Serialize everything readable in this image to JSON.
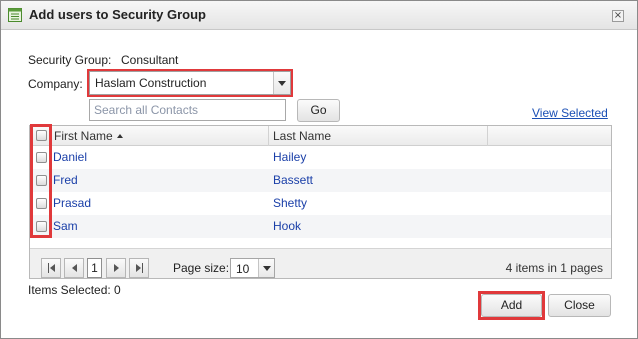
{
  "dialog": {
    "title": "Add users to Security Group",
    "close_glyph": "×"
  },
  "security_group": {
    "label": "Security Group:",
    "value": "Consultant"
  },
  "company": {
    "label": "Company:",
    "selected": "Haslam Construction"
  },
  "search": {
    "value": "",
    "placeholder": "Search all Contacts",
    "go_label": "Go"
  },
  "view_selected_label": "View Selected",
  "table": {
    "columns": [
      "First Name",
      "Last Name",
      ""
    ],
    "sort": {
      "column": "First Name",
      "direction": "ascending"
    },
    "rows": [
      {
        "first": "Daniel",
        "last": "Hailey",
        "checked": false
      },
      {
        "first": "Fred",
        "last": "Bassett",
        "checked": false
      },
      {
        "first": "Prasad",
        "last": "Shetty",
        "checked": false
      },
      {
        "first": "Sam",
        "last": "Hook",
        "checked": false
      }
    ]
  },
  "pager": {
    "current_page": "1",
    "page_size_label": "Page size:",
    "page_size": "10",
    "info": "4 items in 1 pages"
  },
  "footer": {
    "items_selected": "Items Selected: 0",
    "add_label": "Add",
    "close_label": "Close"
  },
  "colors": {
    "accent_highlight": "#e0393b",
    "link": "#1a3fa8"
  }
}
